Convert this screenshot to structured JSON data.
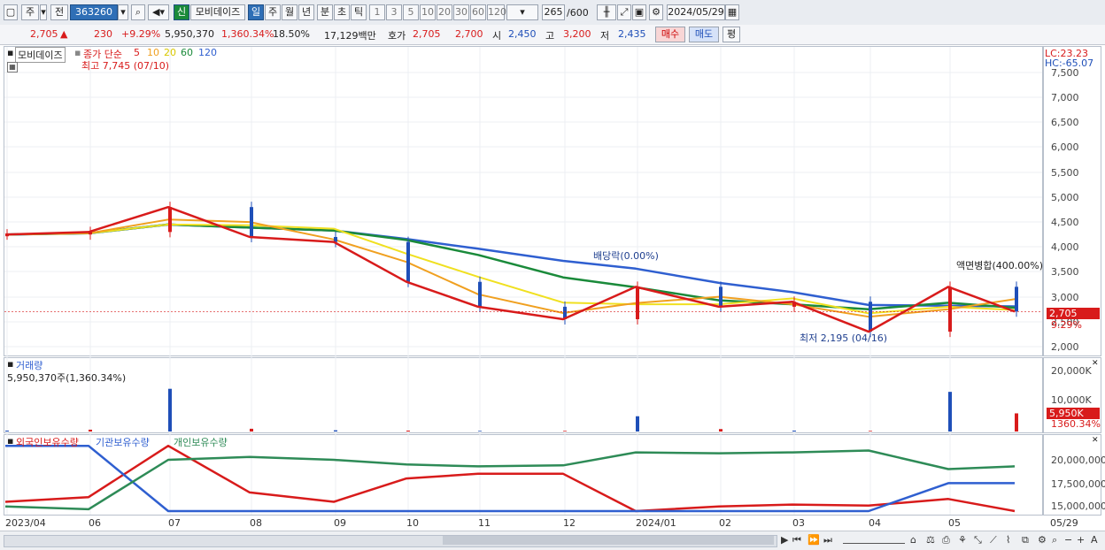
{
  "toolbar": {
    "market_type": "주",
    "prev_label": "전",
    "code": "363260",
    "new_label": "신",
    "stock_name": "모비데이즈",
    "period_tabs": [
      "일",
      "주",
      "월",
      "년",
      "분",
      "초",
      "틱"
    ],
    "interval_buttons": [
      "1",
      "3",
      "5",
      "10",
      "20",
      "30",
      "60",
      "120"
    ],
    "count_value": "265",
    "count_total": "/600",
    "date": "2024/05/29"
  },
  "infobar": {
    "price": "2,705",
    "change": "230",
    "change_pct": "+9.29%",
    "volume": "5,950,370",
    "volume_ratio": "1,360.34%",
    "turnover": "18.50%",
    "amount": "17,129백만",
    "ask_label": "호가",
    "ask_price": "2,705",
    "bid_price": "2,700",
    "open_label": "시",
    "open": "2,450",
    "high_label": "고",
    "high": "3,200",
    "low_label": "저",
    "low": "2,435",
    "buy_button": "매수",
    "sell_button": "매도",
    "eval_button": "평"
  },
  "price_panel": {
    "name_label": "모비데이즈",
    "ma_legend_prefix": "종가 단순",
    "ma_periods": [
      "5",
      "10",
      "20",
      "60",
      "120"
    ],
    "ma_colors": [
      "#d81b1b",
      "#f0a020",
      "#f0e020",
      "#1a8a3a",
      "#2f5fd0"
    ],
    "high_annotation": "최고 7,745 (07/10)",
    "low_annotation": "최저 2,195 (04/16)",
    "dividend_annotation": "배당락(0.00%)",
    "merge_annotation": "액면병합(400.00%)",
    "lc_label": "LC:23.23",
    "hc_label": "HC:-65.07",
    "price_badge": "2,705",
    "pct_badge": "9.29%",
    "y_ticks": [
      "7,500",
      "7,000",
      "6,500",
      "6,000",
      "5,500",
      "5,000",
      "4,500",
      "4,000",
      "3,500",
      "3,000",
      "2,500",
      "2,000"
    ]
  },
  "volume_panel": {
    "title": "거래량",
    "subtitle": "5,950,370주(1,360.34%)",
    "y_ticks": [
      "20,000K",
      "10,000K"
    ],
    "volume_badge": "5,950K",
    "ratio_badge": "1360.34%"
  },
  "holder_panel": {
    "legend": [
      "외국인보유수량",
      "기관보유수량",
      "개인보유수량"
    ],
    "legend_colors": [
      "#d81b1b",
      "#2f5fd0",
      "#2e8b57"
    ],
    "y_ticks": [
      "20,000,000",
      "17,500,000",
      "15,000,000"
    ]
  },
  "x_axis": {
    "ticks": [
      "2023/04",
      "06",
      "07",
      "08",
      "09",
      "10",
      "11",
      "12",
      "2024/01",
      "02",
      "03",
      "04",
      "05",
      "05/29"
    ]
  },
  "chart_data": {
    "type": "line",
    "title": "",
    "x": [
      "2023/04",
      "06",
      "07",
      "08",
      "09",
      "10",
      "11",
      "12",
      "2024/01",
      "02",
      "03",
      "04",
      "05",
      "05/29"
    ],
    "series": [
      {
        "name": "종가",
        "values": [
          4250,
          4300,
          4800,
          4200,
          4100,
          3300,
          2800,
          2550,
          3200,
          2800,
          2900,
          2300,
          3200,
          2705
        ]
      },
      {
        "name": "거래량",
        "unit": "K",
        "values": [
          300,
          600,
          14000,
          900,
          400,
          300,
          200,
          200,
          5000,
          800,
          300,
          200,
          13000,
          5950
        ]
      },
      {
        "name": "외국인보유수량",
        "values": [
          15500000,
          16000000,
          21500000,
          16500000,
          15500000,
          18000000,
          18500000,
          18500000,
          14500000,
          15000000,
          15200000,
          15100000,
          15800000,
          14500000
        ]
      },
      {
        "name": "기관보유수량",
        "values": [
          21500000,
          21500000,
          14500000,
          14500000,
          14500000,
          14500000,
          14500000,
          14500000,
          14500000,
          14500000,
          14500000,
          14500000,
          17500000,
          17500000
        ]
      },
      {
        "name": "개인보유수량",
        "values": [
          15000000,
          14700000,
          20000000,
          20300000,
          20000000,
          19500000,
          19300000,
          19400000,
          20800000,
          20700000,
          20800000,
          21000000,
          19000000,
          19300000
        ]
      }
    ],
    "ylim": [
      2000,
      7745
    ]
  }
}
